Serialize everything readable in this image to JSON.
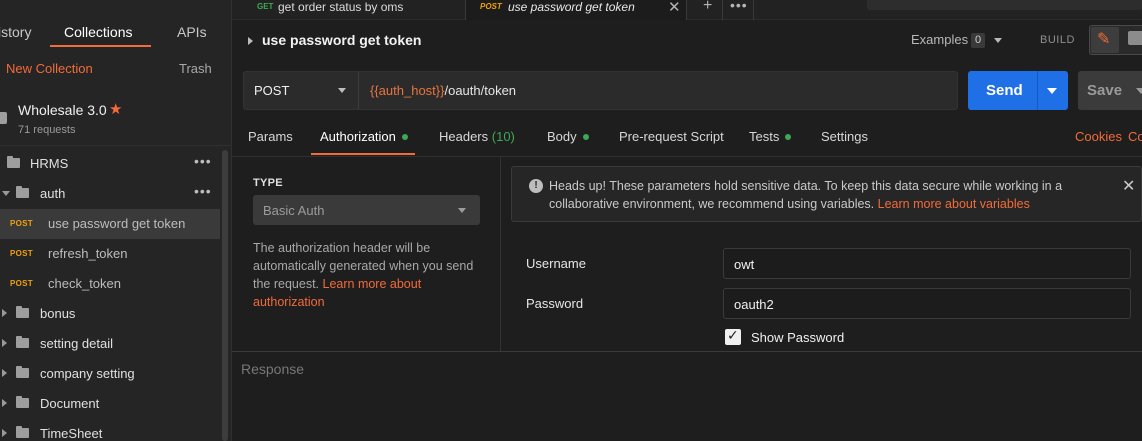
{
  "sidebar": {
    "tabs": {
      "history": "istory",
      "collections": "Collections",
      "apis": "APIs"
    },
    "new_collection": "New Collection",
    "trash": "Trash",
    "collection": {
      "name": "Wholesale 3.0",
      "star": "★",
      "count": "71 requests"
    },
    "tree": {
      "hrms": "HRMS",
      "auth": "auth",
      "req_method": "POST",
      "use_password": "use password get token",
      "refresh": "refresh_token",
      "check": "check_token",
      "bonus": "bonus",
      "setting_detail": "setting detail",
      "company_setting": "company setting",
      "document": "Document",
      "timesheet": "TimeSheet",
      "more": "•••"
    }
  },
  "tabs": {
    "tab1": {
      "method": "GET",
      "title": "get order status by oms",
      "method_color": "#3ea855"
    },
    "tab2": {
      "method": "POST",
      "title": "use password get token",
      "method_color": "#f0a20b"
    },
    "close": "✕",
    "plus": "+",
    "more": "•••"
  },
  "request": {
    "title": "use password get token",
    "examples_label": "Examples",
    "examples_count": "0",
    "build": "BUILD",
    "method": "POST",
    "url_var": "{{auth_host}}",
    "url_path": "/oauth/token",
    "send": "Send",
    "save": "Save"
  },
  "subtabs": {
    "params": "Params",
    "authorization": "Authorization",
    "headers": "Headers",
    "headers_count": "(10)",
    "body": "Body",
    "prerequest": "Pre-request Script",
    "tests": "Tests",
    "settings": "Settings",
    "cookies": "Cookies",
    "code": "Co"
  },
  "auth": {
    "type_label": "TYPE",
    "type_value": "Basic Auth",
    "help_text": "The authorization header will be automatically generated when you send the request. ",
    "help_link": "Learn more about authorization",
    "headsup_icon": "!",
    "headsup_text": "Heads up! These parameters hold sensitive data. To keep this data secure while working in a collaborative environment, we recommend using variables. ",
    "headsup_link": "Learn more about variables",
    "headsup_close": "✕",
    "username_label": "Username",
    "username_value": "owt",
    "password_label": "Password",
    "password_value": "oauth2",
    "show_password": "Show Password",
    "show_password_checked": true
  },
  "response": {
    "label": "Response"
  },
  "colors": {
    "accent": "#f26b3a",
    "send": "#1f6fe6",
    "dot": "#3ea855",
    "post": "#f0a20b"
  }
}
